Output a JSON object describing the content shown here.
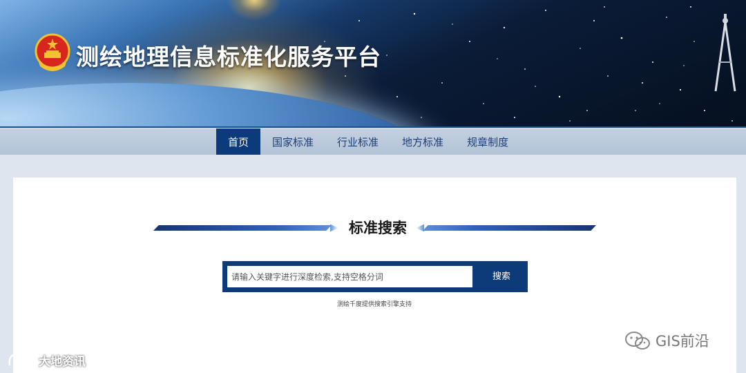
{
  "header": {
    "site_title": "测绘地理信息标准化服务平台"
  },
  "nav": {
    "items": [
      {
        "label": "首页",
        "active": true
      },
      {
        "label": "国家标准",
        "active": false
      },
      {
        "label": "行业标准",
        "active": false
      },
      {
        "label": "地方标准",
        "active": false
      },
      {
        "label": "规章制度",
        "active": false
      }
    ]
  },
  "main": {
    "section_title": "标准搜索",
    "search": {
      "placeholder": "请输入关键字进行深度检索,支持空格分词",
      "button_label": "搜索"
    },
    "powered_by": "测绘千度提供搜索引擎支持"
  },
  "watermarks": {
    "left_text": "大地资讯",
    "right_text": "GIS前沿"
  },
  "colors": {
    "nav_active": "#0c3b7c",
    "nav_bg": "#b8c6d9",
    "page_bg": "#dfe5ee",
    "search_frame": "#0d3a78",
    "nav_text": "#1d3f78"
  }
}
